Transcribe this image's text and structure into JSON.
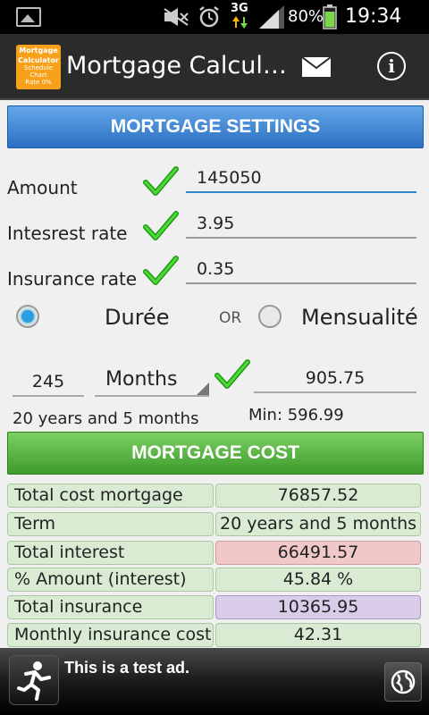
{
  "status_bar": {
    "battery": "80%",
    "network": "3G",
    "time": "19:34"
  },
  "app_bar": {
    "logo_lines": [
      "Mortgage",
      "Calculator",
      "Schedule",
      "Chart",
      "Rate 0%"
    ],
    "title": "Mortgage Calcul…",
    "info_label": "i"
  },
  "settings": {
    "header": "MORTGAGE SETTINGS",
    "amount_label": "Amount",
    "amount_value": "145050",
    "rate_label": "Intesrest rate",
    "rate_value": "3.95",
    "insurance_label": "Insurance rate",
    "insurance_value": "0.35"
  },
  "mode": {
    "option1": "Durée",
    "or": "OR",
    "option2": "Mensualité",
    "selected": "Durée"
  },
  "duration": {
    "value": "245",
    "unit": "Months",
    "description": "20 years and 5 months",
    "monthly": "905.75",
    "min_text": "Min: 596.99"
  },
  "cost": {
    "header": "MORTGAGE COST",
    "rows": [
      {
        "label": "Total cost mortgage",
        "value": "76857.52"
      },
      {
        "label": "Term",
        "value": "20 years and 5 months"
      },
      {
        "label": "Total interest",
        "value": "66491.57"
      },
      {
        "label": "% Amount (interest)",
        "value": "45.84 %"
      },
      {
        "label": "Total insurance",
        "value": "10365.95"
      },
      {
        "label": "Monthly insurance cost",
        "value": "42.31"
      }
    ]
  },
  "ad": {
    "text": "This is a test ad."
  },
  "colors": {
    "settings_header": "#2a6fc2",
    "cost_header": "#3e9b2c",
    "row_green": "#d9ecd3",
    "row_red": "#f1c8c8",
    "row_purple": "#d9cdea",
    "check_green": "#2bbf1e",
    "radio_active": "#2a9fe0"
  }
}
